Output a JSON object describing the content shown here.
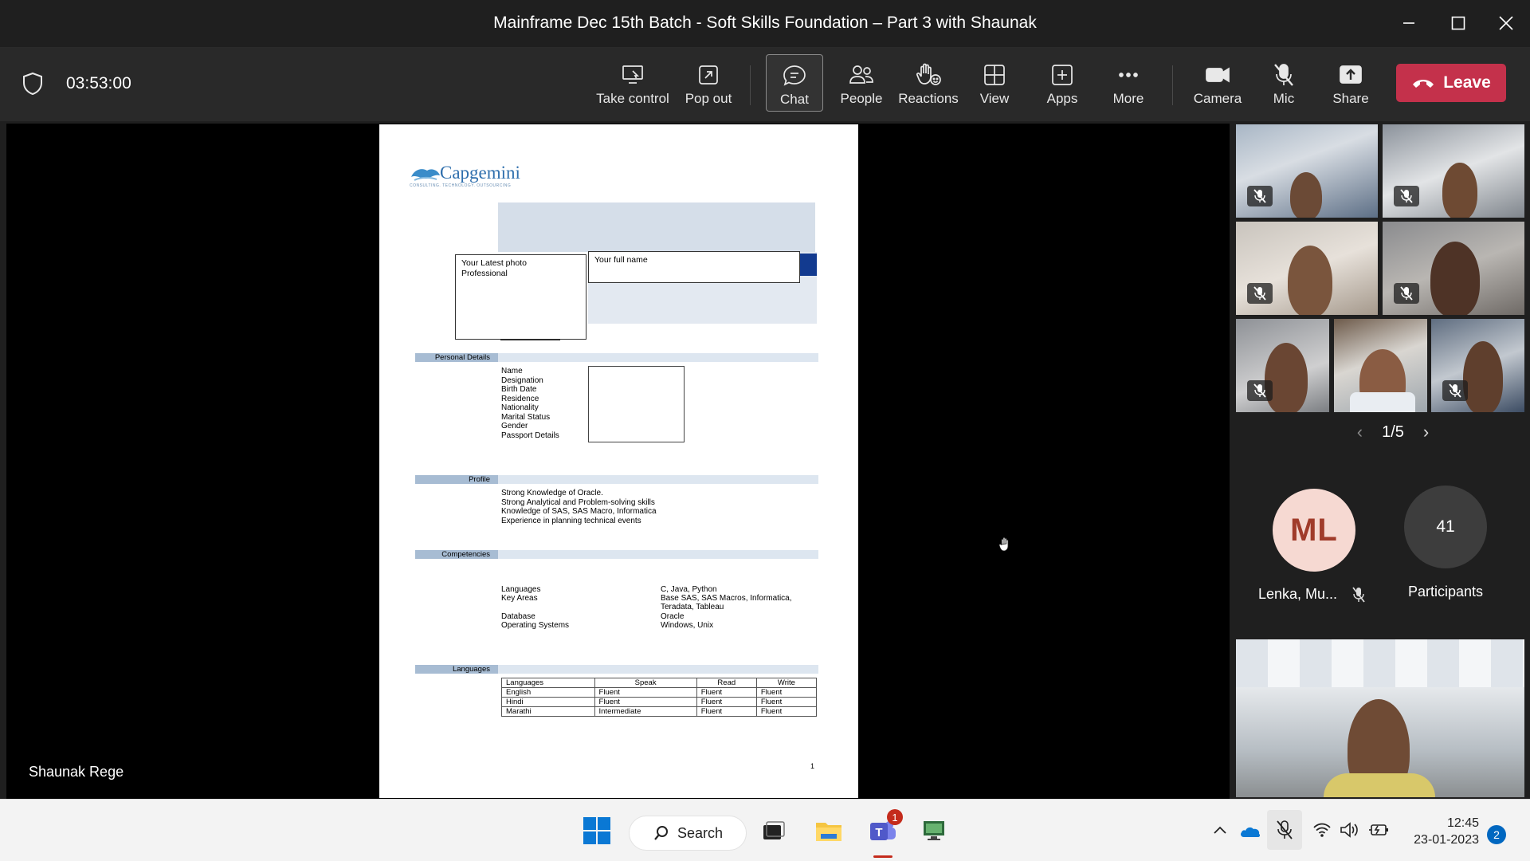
{
  "window": {
    "title": "Mainframe Dec 15th Batch - Soft Skills Foundation – Part 3 with  Shaunak"
  },
  "toolbar": {
    "timer": "03:53:00",
    "buttons": [
      {
        "id": "take-control",
        "label": "Take control",
        "icon": "take-control-icon"
      },
      {
        "id": "pop-out",
        "label": "Pop out",
        "icon": "pop-out-icon"
      },
      {
        "id": "chat",
        "label": "Chat",
        "icon": "chat-icon",
        "active": true
      },
      {
        "id": "people",
        "label": "People",
        "icon": "people-icon"
      },
      {
        "id": "reactions",
        "label": "Reactions",
        "icon": "reactions-icon"
      },
      {
        "id": "view",
        "label": "View",
        "icon": "view-icon"
      },
      {
        "id": "apps",
        "label": "Apps",
        "icon": "apps-icon"
      },
      {
        "id": "more",
        "label": "More",
        "icon": "more-icon"
      },
      {
        "id": "camera",
        "label": "Camera",
        "icon": "camera-icon"
      },
      {
        "id": "mic",
        "label": "Mic",
        "icon": "mic-off-icon"
      },
      {
        "id": "share",
        "label": "Share",
        "icon": "share-icon"
      }
    ],
    "leave_label": "Leave",
    "leave_color": "#c4314b"
  },
  "stage": {
    "presenter_name": "Shaunak Rege"
  },
  "document": {
    "logo_text": "Capgemini",
    "logo_tagline": "CONSULTING. TECHNOLOGY. OUTSOURCING",
    "photo_box": "Your Latest photo\nProfessional",
    "name_box": "Your full name",
    "sections": {
      "personal": "Personal Details",
      "profile": "Profile",
      "competencies": "Competencies",
      "languages": "Languages"
    },
    "personal_fields": [
      "Name",
      "Designation",
      "Birth Date",
      "Residence",
      "Nationality",
      "Marital Status",
      "Gender",
      "Passport Details"
    ],
    "profile_lines": [
      "Strong Knowledge of Oracle.",
      "Strong Analytical and Problem-solving skills",
      "Knowledge of SAS, SAS Macro, Informatica",
      "Experience in planning technical events"
    ],
    "competencies": {
      "languages_label": "Languages",
      "languages_value": "C, Java, Python",
      "key_areas_label": "Key Areas",
      "key_areas_value_1": "Base SAS, SAS Macros, Informatica,",
      "key_areas_value_2": "Teradata, Tableau",
      "database_label": "Database",
      "database_value": "Oracle",
      "os_label": "Operating Systems",
      "os_value": "Windows, Unix"
    },
    "lang_table": {
      "headers": [
        "Languages",
        "Speak",
        "Read",
        "Write"
      ],
      "rows": [
        [
          "English",
          "Fluent",
          "Fluent",
          "Fluent"
        ],
        [
          "Hindi",
          "Fluent",
          "Fluent",
          "Fluent"
        ],
        [
          "Marathi",
          "Intermediate",
          "Fluent",
          "Fluent"
        ]
      ]
    },
    "page_number": "1"
  },
  "panel": {
    "pager": "1/5",
    "avatar_initials": "ML",
    "avatar_name": "Lenka, Mu...",
    "participant_count": "41",
    "participants_label": "Participants"
  },
  "taskbar": {
    "search_label": "Search",
    "teams_badge": "1",
    "time": "12:45",
    "date": "23-01-2023",
    "notification_count": "2"
  }
}
